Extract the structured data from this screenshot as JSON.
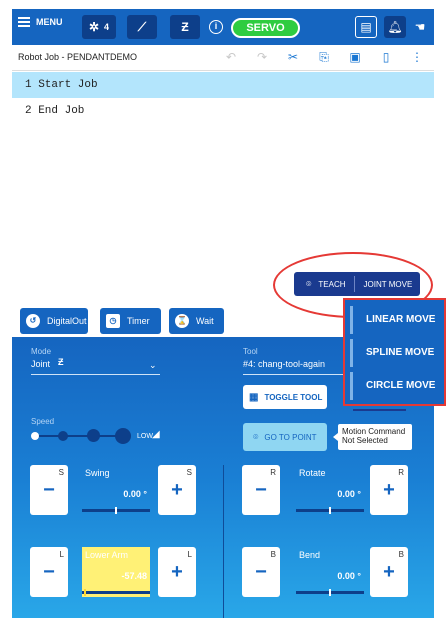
{
  "topbar": {
    "menu_label": "MENU",
    "tool_count": "4",
    "servo_label": "SERVO",
    "info_symbol": "i"
  },
  "job": {
    "title": "Robot Job - PENDANTDEMO",
    "lines": [
      "1 Start Job",
      "2 End Job"
    ]
  },
  "teach": {
    "teach_label": "TEACH",
    "move_label": "JOINT MOVE"
  },
  "action_buttons": {
    "digital_out": "DigitalOut",
    "timer": "Timer",
    "wait": "Wait"
  },
  "move_menu": {
    "items": [
      "LINEAR MOVE",
      "SPLINE MOVE",
      "CIRCLE MOVE"
    ]
  },
  "panel": {
    "mode_label": "Mode",
    "mode_value": "Joint",
    "tool_label": "Tool",
    "tool_value": "#4: chang-tool-again",
    "toggle_tool": "TOGGLE TOOL",
    "go_to_point": "GO TO POINT",
    "tooltip_text": "Motion Command Not Selected",
    "speed_label": "Speed",
    "speed_value": "LOW",
    "speed_level": 0.25
  },
  "jog": [
    {
      "name": "Swing",
      "value": "0.00 °",
      "axis": "S",
      "highlight": false
    },
    {
      "name": "Rotate",
      "value": "0.00 °",
      "axis": "R",
      "highlight": false
    },
    {
      "name": "Lower Arm",
      "value": "-57.48",
      "axis": "L",
      "highlight": true
    },
    {
      "name": "Bend",
      "value": "0.00 °",
      "axis": "B",
      "highlight": false
    }
  ],
  "colors": {
    "accent": "#1565c0",
    "servo": "#2ecc40",
    "highlight": "#fff176",
    "annotation": "#e53935"
  },
  "icons": [
    "menu-icon",
    "robot-icon",
    "axis-icon",
    "z-axis-icon",
    "info-icon",
    "message-icon",
    "bell-icon",
    "hand-icon",
    "undo-icon",
    "redo-icon",
    "cut-icon",
    "copy-icon",
    "paste-icon",
    "delete-icon",
    "more-icon",
    "pin-icon",
    "timer-icon",
    "wait-icon",
    "toggle-tool-icon"
  ]
}
